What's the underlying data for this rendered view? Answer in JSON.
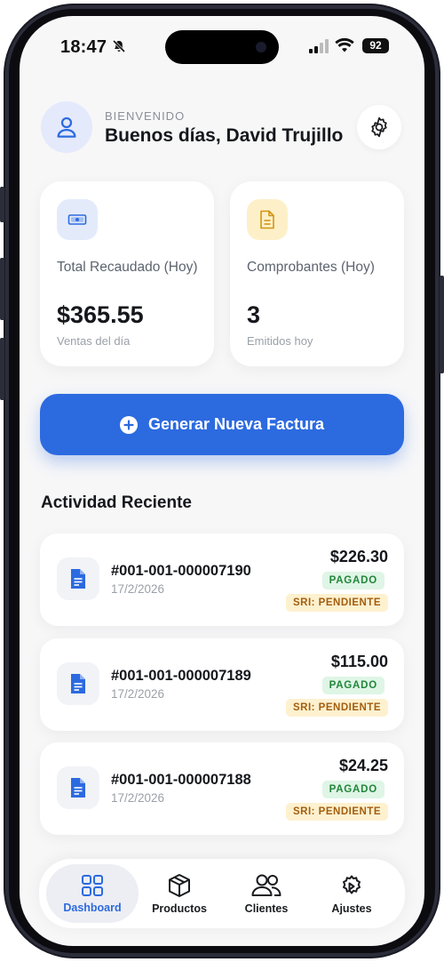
{
  "status_bar": {
    "time": "18:47",
    "battery": "92"
  },
  "header": {
    "eyebrow": "BIENVENIDO",
    "greeting": "Buenos días, David Trujillo"
  },
  "stats": [
    {
      "label": "Total Recaudado (Hoy)",
      "value": "$365.55",
      "sub": "Ventas del día",
      "icon": "cash-icon",
      "icon_bg": "#e3ebfb",
      "icon_color": "#2c6ae0"
    },
    {
      "label": "Comprobantes (Hoy)",
      "value": "3",
      "sub": "Emitidos hoy",
      "icon": "document-icon",
      "icon_bg": "#fdf0c8",
      "icon_color": "#d39514"
    }
  ],
  "cta": {
    "label": "Generar Nueva Factura",
    "color": "#2c6ae0"
  },
  "activity": {
    "title": "Actividad Reciente",
    "items": [
      {
        "id": "#001-001-000007190",
        "date": "17/2/2026",
        "amount": "$226.30",
        "status": "PAGADO",
        "sri": "SRI: PENDIENTE"
      },
      {
        "id": "#001-001-000007189",
        "date": "17/2/2026",
        "amount": "$115.00",
        "status": "PAGADO",
        "sri": "SRI: PENDIENTE"
      },
      {
        "id": "#001-001-000007188",
        "date": "17/2/2026",
        "amount": "$24.25",
        "status": "PAGADO",
        "sri": "SRI: PENDIENTE"
      }
    ]
  },
  "nav": {
    "items": [
      {
        "label": "Dashboard",
        "icon": "grid-icon",
        "active": true
      },
      {
        "label": "Productos",
        "icon": "box-icon",
        "active": false
      },
      {
        "label": "Clientes",
        "icon": "users-icon",
        "active": false
      },
      {
        "label": "Ajustes",
        "icon": "settings-gear-icon",
        "active": false
      }
    ]
  },
  "colors": {
    "accent": "#2c6ae0",
    "paid_bg": "#dff5e6",
    "paid_text": "#22863a",
    "pending_bg": "#fdf1cf",
    "pending_text": "#a45d0c"
  }
}
